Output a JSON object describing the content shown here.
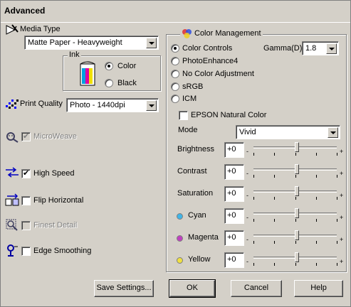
{
  "window": {
    "title": "Advanced"
  },
  "left": {
    "media_type": {
      "label": "Media Type",
      "value": "Matte Paper - Heavyweight"
    },
    "ink": {
      "label": "Ink",
      "options": [
        {
          "label": "Color",
          "selected": true
        },
        {
          "label": "Black",
          "selected": false
        }
      ]
    },
    "print_quality": {
      "label": "Print Quality",
      "value": "Photo - 1440dpi"
    },
    "microweave": {
      "label": "MicroWeave",
      "checked": true,
      "enabled": false
    },
    "high_speed": {
      "label": "High Speed",
      "checked": true,
      "enabled": true
    },
    "flip_horizontal": {
      "label": "Flip Horizontal",
      "checked": false,
      "enabled": true
    },
    "finest_detail": {
      "label": "Finest Detail",
      "checked": false,
      "enabled": false
    },
    "edge_smoothing": {
      "label": "Edge Smoothing",
      "checked": false,
      "enabled": true
    }
  },
  "color_management": {
    "label": "Color Management",
    "options": [
      {
        "label": "Color Controls",
        "selected": true
      },
      {
        "label": "PhotoEnhance4",
        "selected": false
      },
      {
        "label": "No Color Adjustment",
        "selected": false
      },
      {
        "label": "sRGB",
        "selected": false
      },
      {
        "label": "ICM",
        "selected": false
      }
    ],
    "gamma": {
      "label": "Gamma(D)",
      "value": "1.8"
    },
    "epson_natural_color": {
      "label": "EPSON Natural Color",
      "checked": false
    },
    "mode": {
      "label": "Mode",
      "value": "Vivid"
    },
    "sliders": [
      {
        "label": "Brightness",
        "value": "+0",
        "level": 0
      },
      {
        "label": "Contrast",
        "value": "+0",
        "level": 0
      },
      {
        "label": "Saturation",
        "value": "+0",
        "level": 0
      },
      {
        "label": "Cyan",
        "value": "+0",
        "level": 0,
        "color": "#3fb5e8"
      },
      {
        "label": "Magenta",
        "value": "+0",
        "level": 0,
        "color": "#c040c0"
      },
      {
        "label": "Yellow",
        "value": "+0",
        "level": 0,
        "color": "#f0e040"
      }
    ],
    "minus": "-",
    "plus": "+"
  },
  "buttons": {
    "save_settings": "Save Settings...",
    "ok": "OK",
    "cancel": "Cancel",
    "help": "Help"
  }
}
